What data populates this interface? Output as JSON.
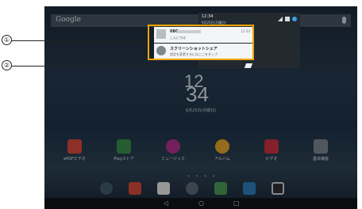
{
  "search": {
    "logo": "Google"
  },
  "clock": {
    "hour": "12",
    "minute": "34",
    "date": "6月25日(月曜日)"
  },
  "apps": [
    {
      "label": "ePDFビデオ",
      "color": "#d94b3c"
    },
    {
      "label": "Playストア",
      "color": "#3a8f4a"
    },
    {
      "label": "ミュージック",
      "color": "#b3318f"
    },
    {
      "label": "アルバム",
      "color": "#e5a62b"
    },
    {
      "label": "ビデオ",
      "color": "#c9323f"
    },
    {
      "label": "基本機能",
      "color": "#7d8890"
    }
  ],
  "page_dots": "• • • •",
  "dock_icons": [
    "chrome-icon",
    "email-icon",
    "contacts-icon",
    "apps-grid-icon",
    "maps-icon",
    "tv-icon",
    "camera-icon"
  ],
  "nav": {
    "back": "◁",
    "home": "○",
    "recents": "□"
  },
  "shade": {
    "time": "12:34",
    "date": "6月25日(月曜日)",
    "notifications": [
      {
        "title": "080",
        "subtitle": "こんにちは",
        "time": "12:34"
      },
      {
        "title": "スクリーンショットシェア",
        "subtitle": "設定を変更するにはここをタップ",
        "time": ""
      }
    ]
  },
  "callouts": [
    "①",
    "②"
  ],
  "colors": {
    "highlight": "#f2a400"
  }
}
